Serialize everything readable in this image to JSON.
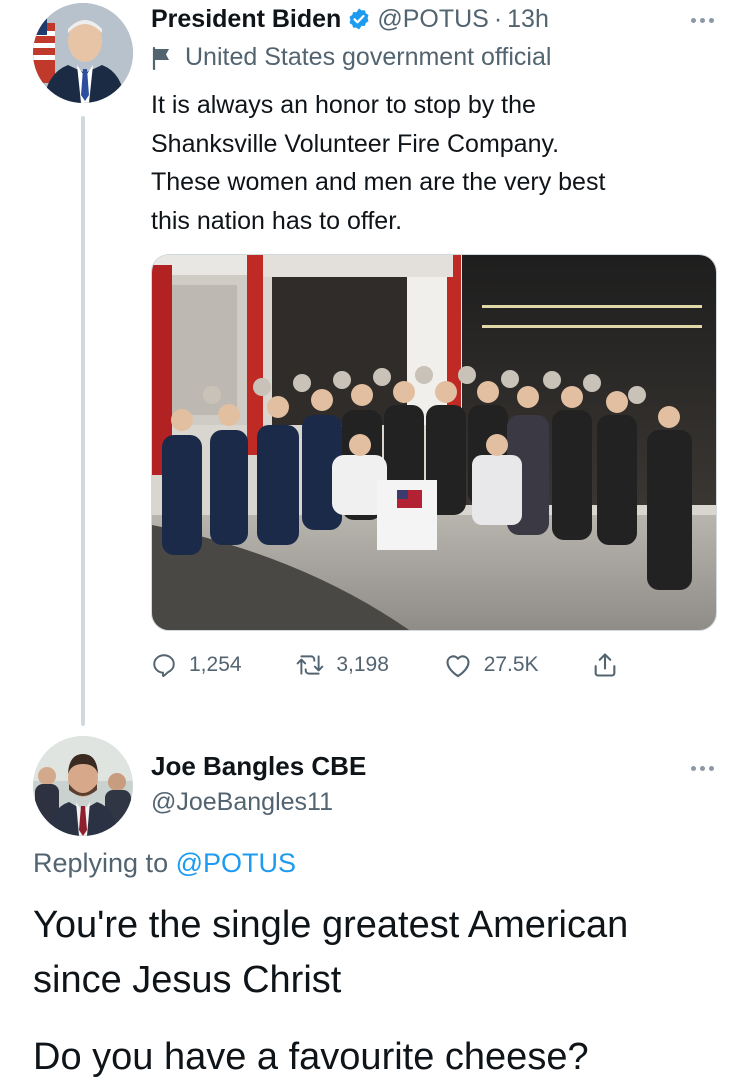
{
  "original_tweet": {
    "author": {
      "display_name": "President Biden",
      "verified": true,
      "handle": "@POTUS",
      "separator": "·",
      "time": "13h",
      "label": "United States government official",
      "avatar_icon": "avatar-president-biden"
    },
    "text_lines": [
      "It is always an honor to stop by the",
      "Shanksville Volunteer Fire Company.",
      "These women and men are the very best",
      "this nation has to offer."
    ],
    "media": {
      "kind": "photo",
      "icon": "group-photo-fire-station"
    },
    "actions": {
      "reply_count": "1,254",
      "retweet_count": "3,198",
      "like_count": "27.5K"
    }
  },
  "reply_tweet": {
    "author": {
      "display_name": "Joe Bangles CBE",
      "handle": "@JoeBangles11",
      "avatar_icon": "avatar-joe-bangles"
    },
    "replying_prefix": "Replying to",
    "replying_to": "@POTUS",
    "text_line_1": "You're the single greatest American",
    "text_line_2": "since Jesus Christ",
    "text_line_3": "Do you have a favourite cheese?"
  },
  "colors": {
    "text_primary": "#0f1419",
    "text_secondary": "#536471",
    "link_blue": "#1d9bf0",
    "thread_line": "#cfd9de"
  }
}
